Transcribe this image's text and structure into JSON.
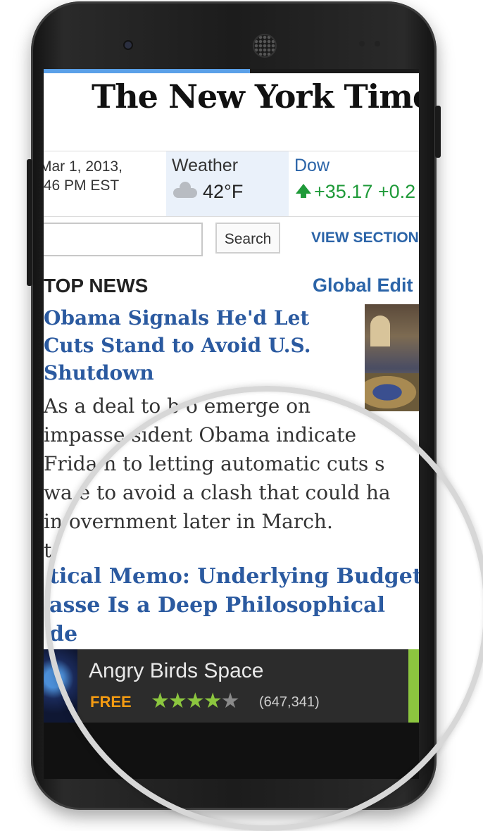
{
  "masthead": {
    "title": "The New York Times"
  },
  "loading": {
    "progress_percent": 55
  },
  "infobar": {
    "date_line1": "Mar 1, 2013,",
    "date_line2": ":46 PM EST",
    "weather_label": "Weather",
    "weather_icon": "cloud-icon",
    "temperature": "42°F",
    "dow_label": "Dow",
    "dow_change": "+35.17 +0.2",
    "dow_color": "#1f9a39"
  },
  "search": {
    "placeholder": "",
    "button_label": "Search",
    "view_sections": "VIEW SECTION"
  },
  "section": {
    "title": "TOP NEWS",
    "edition_link": "Global Edit"
  },
  "article": {
    "headline": "Obama Signals He'd Let Cuts Stand to Avoid U.S. Shutdown",
    "summary_line1": "As a deal to b  o emerge on",
    "summary_line2": "impasse  sident Obama indicate",
    "summary_line3": "Frida   n to letting automatic cuts s",
    "summary_line4": "wa   e to avoid a clash that could ha",
    "summary_line5": "in  overnment later in March.",
    "summary_line6": "t"
  },
  "memo": {
    "line1": "tical Memo: Underlying Budget",
    "line2": "asse Is a Deep Philosophical",
    "line3": "de"
  },
  "ad": {
    "title": "Angry Birds Space",
    "price": "FREE",
    "rating": 3.5,
    "rating_count": "(647,341)",
    "accent_color": "#8cc63f",
    "price_color": "#f49b12",
    "download_icon": "download-icon"
  },
  "colors": {
    "link": "#2b5aa0",
    "bezel": "#1c1c1c"
  }
}
